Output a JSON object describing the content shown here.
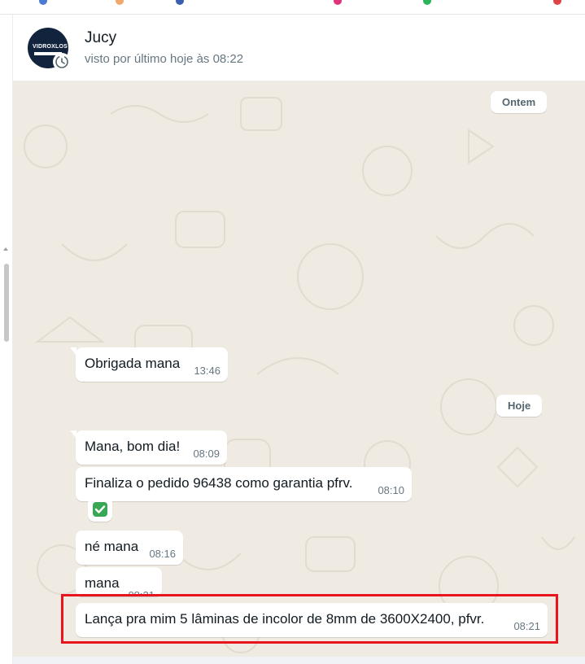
{
  "contact": {
    "name": "Jucy",
    "status": "visto por último hoje às 08:22",
    "avatar_logo": "VIDROXLOS"
  },
  "date_separators": {
    "yesterday": "Ontem",
    "today": "Hoje"
  },
  "messages": [
    {
      "text": "Obrigada mana",
      "time": "13:46"
    },
    {
      "text": "Mana, bom dia!",
      "time": "08:09"
    },
    {
      "text": "Finaliza o pedido 96438 como garantia pfrv.",
      "time": "08:10"
    },
    {
      "text": "né mana",
      "time": "08:16"
    },
    {
      "text": "mana",
      "time": "08:21"
    },
    {
      "text": "Lança pra mim 5 lâminas de incolor de 8mm de 3600X2400, pfvr.",
      "time": "08:21"
    }
  ],
  "reaction": {
    "icon": "white-check-mark-icon"
  },
  "colors": {
    "chat_background": "#efeae2",
    "bubble": "#ffffff",
    "highlight": "#e8141e",
    "timestamp": "#667781"
  }
}
